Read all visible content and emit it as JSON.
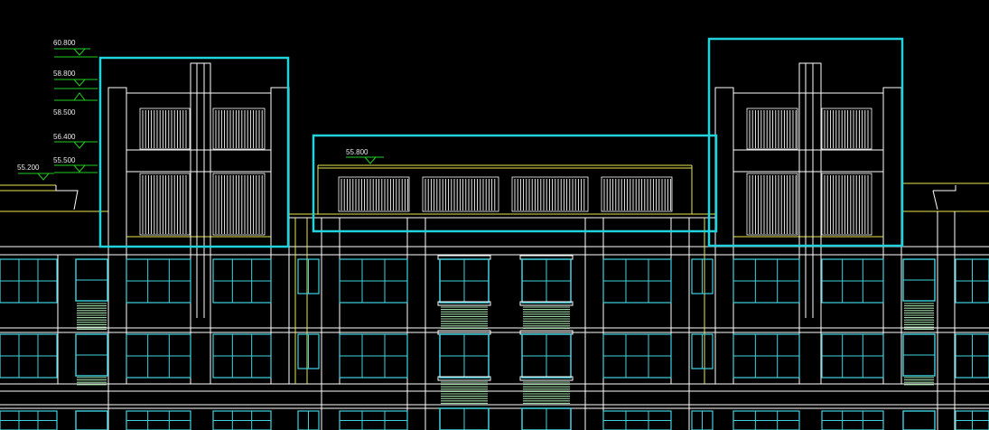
{
  "colors": {
    "background": "#000000",
    "outline": "#ffffff",
    "guide": "#e8e850",
    "window": "#3fd3e0",
    "elevation_mark": "#22cc22",
    "selection": "#22d3de",
    "grille": "#9fd8a6"
  },
  "elevation_marks": {
    "e1": "60.800",
    "e2": "58.800",
    "e3": "58.500",
    "e4": "56.400",
    "e5": "55.500",
    "e6": "55.200",
    "e7": "55.800"
  }
}
